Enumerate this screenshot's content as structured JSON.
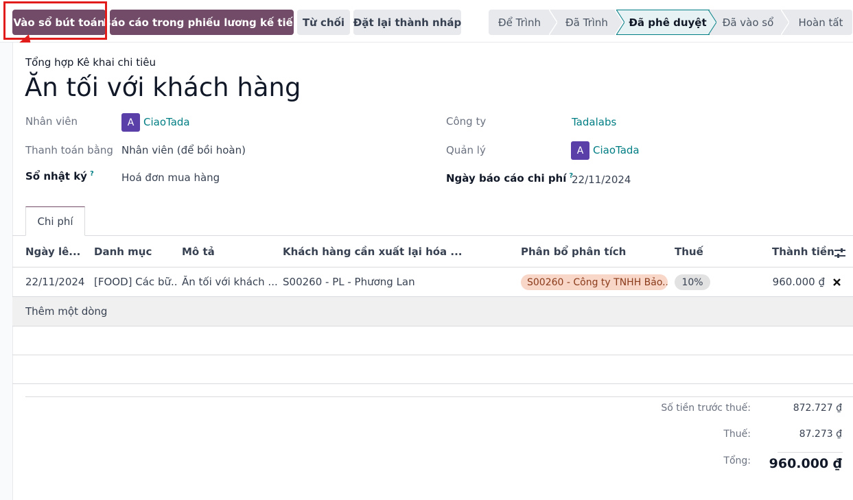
{
  "toolbar": {
    "post_entries": "Vào sổ bút toán",
    "report_next_payslip": "Báo cáo trong phiếu lương kế tiếp",
    "refuse": "Từ chối",
    "reset_draft": "Đặt lại thành nháp"
  },
  "statusbar": {
    "stages": [
      "Để Trình",
      "Đã Trình",
      "Đã phê duyệt",
      "Đã vào sổ",
      "Hoàn tất"
    ],
    "current": "Đã phê duyệt"
  },
  "form": {
    "subtitle": "Tổng hợp Kê khai chi tiêu",
    "title": "Ăn tối với khách hàng",
    "employee_label": "Nhân viên",
    "employee_avatar": "A",
    "employee_value": "CiaoTada",
    "paid_by_label": "Thanh toán bằng",
    "paid_by_value": "Nhân viên (để bồi hoàn)",
    "journal_label": "Sổ nhật ký",
    "journal_help": "?",
    "journal_value": "Hoá đơn mua hàng",
    "company_label": "Công ty",
    "company_value": "Tadalabs",
    "manager_label": "Quản lý",
    "manager_avatar": "A",
    "manager_value": "CiaoTada",
    "report_date_label": "Ngày báo cáo chi phí",
    "report_date_help": "?",
    "report_date_value": "22/11/2024"
  },
  "tabs": {
    "expenses": "Chi phí"
  },
  "table": {
    "headers": {
      "date": "Ngày lê...",
      "category": "Danh mục",
      "description": "Mô tả",
      "customer": "Khách hàng cần xuất lại hóa ...",
      "analytic": "Phân bổ phân tích",
      "tax": "Thuế",
      "total": "Thành tiền"
    },
    "rows": [
      {
        "date": "22/11/2024",
        "category": "[FOOD] Các bữ...",
        "description": "Ăn tối với khách ...",
        "customer": "S00260 - PL - Phương Lan",
        "analytic": "S00260 - Công ty TNHH Bảo...",
        "tax": "10%",
        "total": "960.000 ₫"
      }
    ],
    "add_line": "Thêm một dòng"
  },
  "totals": {
    "untaxed_label": "Số tiền trước thuế:",
    "untaxed_value": "872.727 ₫",
    "tax_label": "Thuế:",
    "tax_value": "87.273 ₫",
    "total_label": "Tổng:",
    "total_value": "960.000 ₫"
  },
  "colors": {
    "primary": "#714b67",
    "link": "#017e84",
    "highlight": "#e21b1b"
  }
}
